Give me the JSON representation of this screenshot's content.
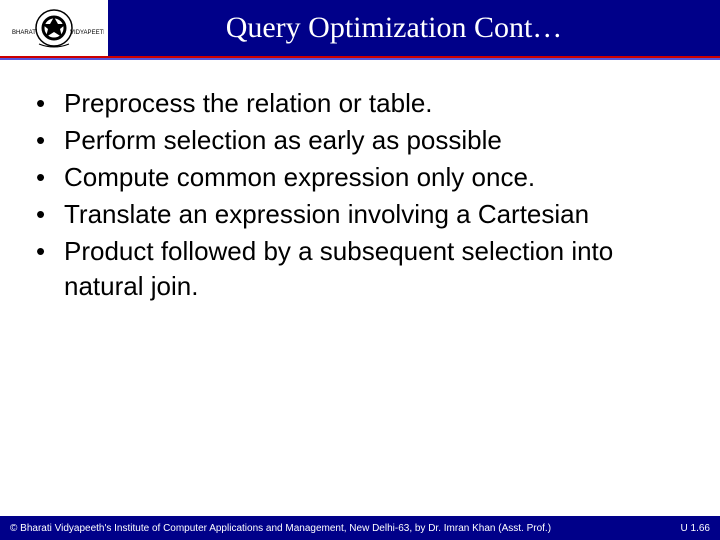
{
  "header": {
    "title": "Query Optimization Cont…",
    "logo_text_left": "BHARATI",
    "logo_text_right": "VIDYAPEETH"
  },
  "bullets": [
    "Preprocess the relation or table.",
    "Perform selection as early as possible",
    "Compute common expression only once.",
    "Translate an expression involving a Cartesian",
    "Product followed by a subsequent selection into natural join."
  ],
  "footer": {
    "left": "© Bharati Vidyapeeth's Institute of Computer Applications and Management, New Delhi-63, by  Dr. Imran Khan (Asst. Prof.)",
    "right": "U 1.66"
  }
}
